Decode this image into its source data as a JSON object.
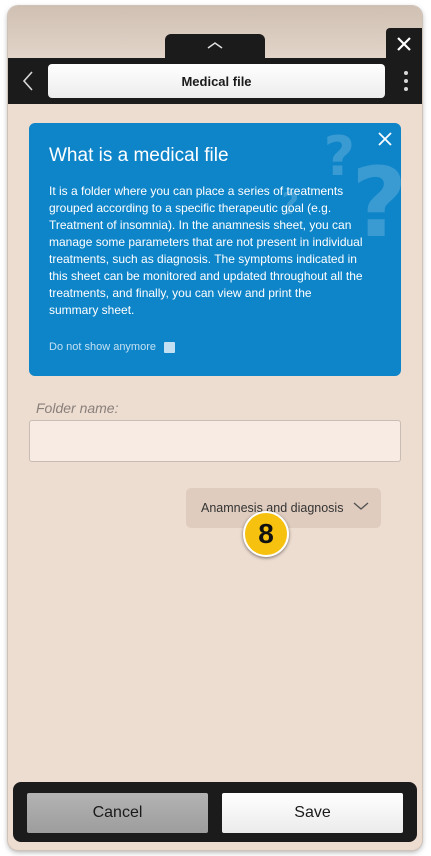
{
  "header": {
    "title": "Medical file"
  },
  "info_card": {
    "title": "What is a medical file",
    "body": "It is a folder where you can place a series of treatments grouped according to a specific therapeutic goal (e.g. Treatment of insomnia). In the anamnesis sheet, you can manage some parameters that are not present in individual treatments, such as diagnosis. The symptoms indicated in this sheet can be monitored and updated throughout all the treatments, and finally, you can view and print the summary sheet.",
    "dont_show_label": "Do not show anymore",
    "decor_glyph": "?"
  },
  "folder_name": {
    "label": "Folder name:",
    "value": "",
    "placeholder": ""
  },
  "anamnesis_dropdown": {
    "label": "Anamnesis and diagnosis"
  },
  "step_badge": {
    "number": "8",
    "color": "#f6c20f"
  },
  "footer": {
    "cancel_label": "Cancel",
    "save_label": "Save"
  },
  "colors": {
    "accent_blue": "#0f85c9",
    "background": "#eddcd0",
    "bar_dark": "#1b1b1b"
  }
}
